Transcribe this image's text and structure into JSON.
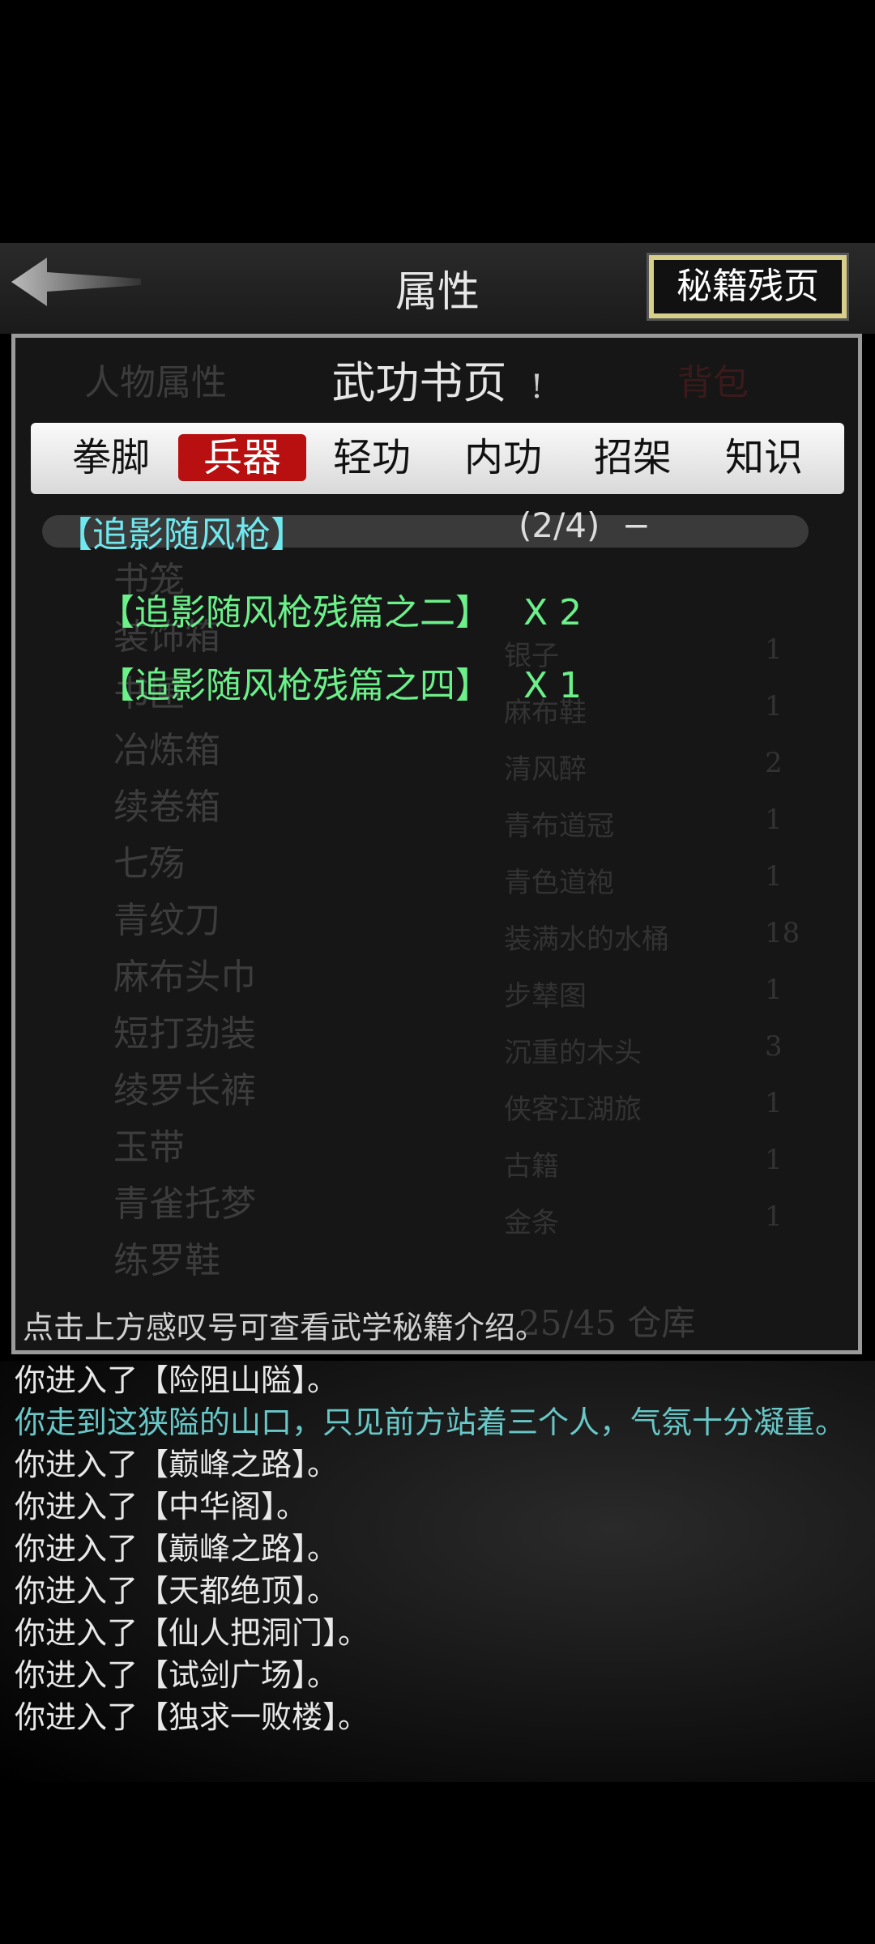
{
  "header": {
    "title": "属性",
    "right_button": "秘籍残页"
  },
  "background": {
    "panel_tabs": [
      "人物属性",
      "背包"
    ],
    "list_left": [
      "书笼",
      "装饰箱",
      "书匣",
      "冶炼箱",
      "续卷箱",
      "七殇",
      "青纹刀",
      "麻布头巾",
      "短打劲装",
      "绫罗长裤",
      "玉带",
      "青雀托梦",
      "练罗鞋"
    ],
    "list_right": [
      {
        "name": "银子",
        "qty": "1"
      },
      {
        "name": "麻布鞋",
        "qty": "1"
      },
      {
        "name": "清风醉",
        "qty": "2"
      },
      {
        "name": "青布道冠",
        "qty": "1"
      },
      {
        "name": "青色道袍",
        "qty": "1"
      },
      {
        "name": "装满水的水桶",
        "qty": "18"
      },
      {
        "name": "步辇图",
        "qty": "1"
      },
      {
        "name": "沉重的木头",
        "qty": "3"
      },
      {
        "name": "侠客江湖旅",
        "qty": "1"
      },
      {
        "name": "古籍",
        "qty": "1"
      },
      {
        "name": "金条",
        "qty": "1"
      }
    ],
    "capacity": "25/45 仓库"
  },
  "page": {
    "heading": "武功书页",
    "alert": "!"
  },
  "tabs": [
    "拳脚",
    "兵器",
    "轻功",
    "内功",
    "招架",
    "知识"
  ],
  "active_tab": 1,
  "book": {
    "name": "【追影随风枪】",
    "count": "(2/4)",
    "toggle": "−",
    "items": [
      {
        "name": "【追影随风枪残篇之二】",
        "qty": "X 2"
      },
      {
        "name": "【追影随风枪残篇之四】",
        "qty": "X 1"
      }
    ]
  },
  "hint": "点击上方感叹号可查看武学秘籍介绍。",
  "log": [
    {
      "text": "你进入了【险阻山隘】。",
      "color": "#e8e8e8"
    },
    {
      "text": "你走到这狭隘的山口，只见前方站着三个人，气氛十分凝重。",
      "color": "#68c7c7"
    },
    {
      "text": "你进入了【巅峰之路】。",
      "color": "#e8e8e8"
    },
    {
      "text": "你进入了【中华阁】。",
      "color": "#e8e8e8"
    },
    {
      "text": "你进入了【巅峰之路】。",
      "color": "#e8e8e8"
    },
    {
      "text": "你进入了【天都绝顶】。",
      "color": "#e8e8e8"
    },
    {
      "text": "你进入了【仙人把洞门】。",
      "color": "#e8e8e8"
    },
    {
      "text": "你进入了【试剑广场】。",
      "color": "#e8e8e8"
    },
    {
      "text": "你进入了【独求一败楼】。",
      "color": "#e8e8e8"
    }
  ],
  "colors": {
    "active_tab": "#b81010",
    "book_name": "#6fe8ee",
    "item_text": "#6bf08a",
    "right_button_frame": "#d8d08a"
  }
}
